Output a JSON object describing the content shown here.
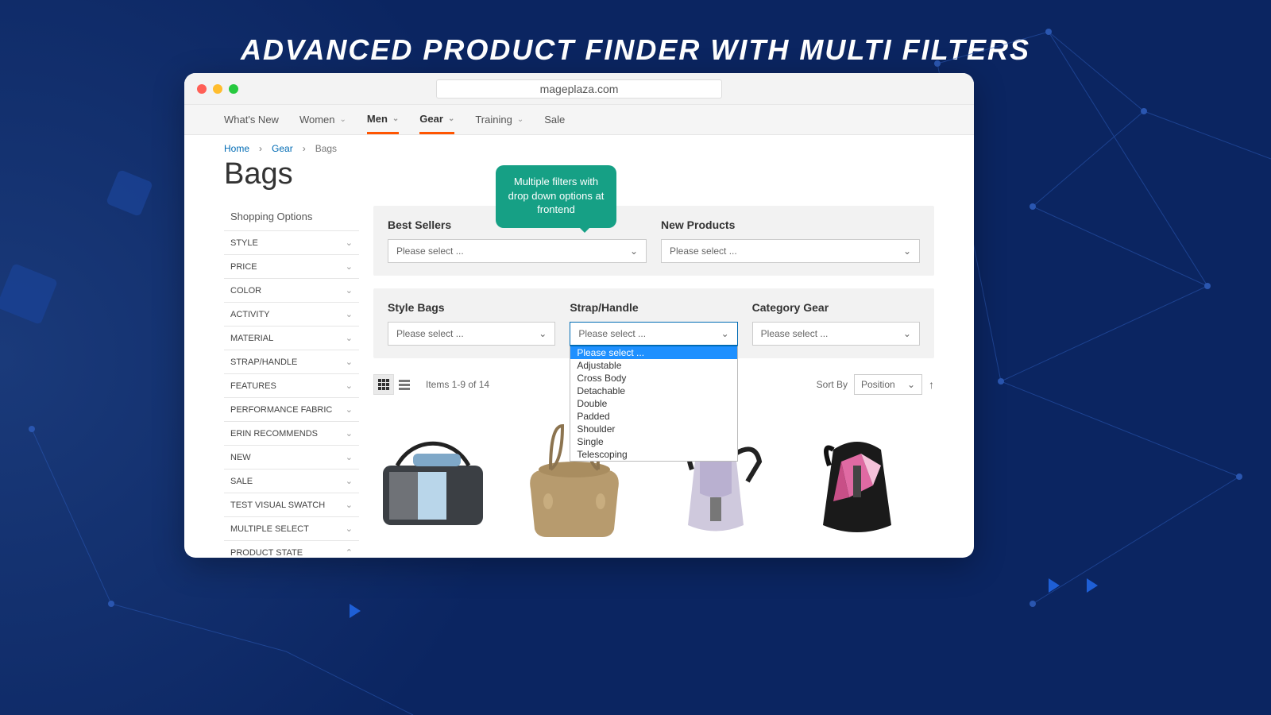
{
  "banner": {
    "title": "ADVANCED PRODUCT FINDER WITH MULTI FILTERS"
  },
  "address_bar": "mageplaza.com",
  "nav": {
    "items": [
      "What's New",
      "Women",
      "Men",
      "Gear",
      "Training",
      "Sale"
    ]
  },
  "breadcrumb": {
    "home": "Home",
    "cat": "Gear",
    "current": "Bags"
  },
  "page_title": "Bags",
  "sidebar": {
    "title": "Shopping Options",
    "options": [
      "STYLE",
      "PRICE",
      "COLOR",
      "ACTIVITY",
      "MATERIAL",
      "STRAP/HANDLE",
      "FEATURES",
      "PERFORMANCE FABRIC",
      "ERIN RECOMMENDS",
      "NEW",
      "SALE",
      "TEST VISUAL SWATCH",
      "MULTIPLE SELECT",
      "PRODUCT STATE"
    ]
  },
  "filters1": {
    "c1": {
      "label": "Best Sellers",
      "placeholder": "Please select ..."
    },
    "c2": {
      "label": "New Products",
      "placeholder": "Please select ..."
    }
  },
  "filters2": {
    "c1": {
      "label": "Style Bags",
      "placeholder": "Please select ..."
    },
    "c2": {
      "label": "Strap/Handle",
      "placeholder": "Please select ..."
    },
    "c3": {
      "label": "Category Gear",
      "placeholder": "Please select ..."
    }
  },
  "strap_options": [
    "Please select ...",
    "Adjustable",
    "Cross Body",
    "Detachable",
    "Double",
    "Padded",
    "Shoulder",
    "Single",
    "Telescoping"
  ],
  "toolbar": {
    "items_text": "Items 1-9 of 14",
    "sort_by_label": "Sort By",
    "sort_value": "Position"
  },
  "callout": "Multiple filters with drop down options at frontend"
}
